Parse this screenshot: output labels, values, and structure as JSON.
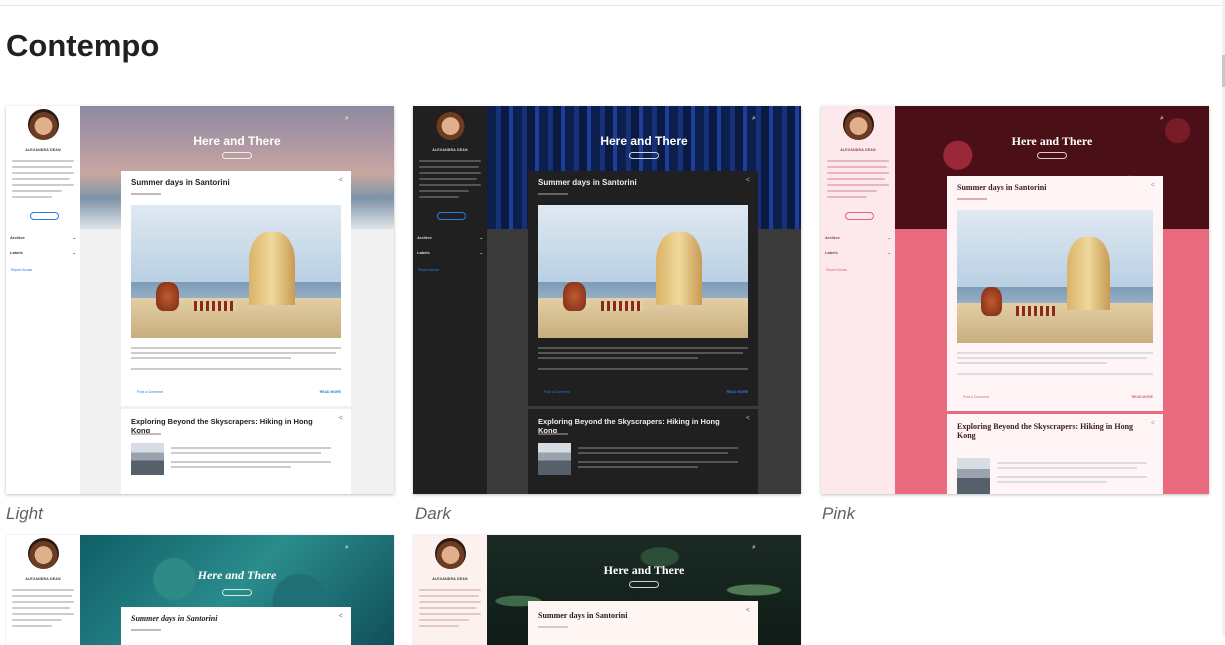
{
  "section": {
    "title": "Contempo"
  },
  "themes": [
    {
      "label": "Light"
    },
    {
      "label": "Dark"
    },
    {
      "label": "Pink"
    },
    {
      "label": ""
    },
    {
      "label": ""
    }
  ],
  "preview": {
    "author": "ALEXANDRA DEAN",
    "blog_title": "Here and There",
    "sidebar_menu": [
      "Archive",
      "Labels"
    ],
    "report_abuse": "Report Abuse",
    "post1_title": "Summer days in Santorini",
    "post2_title": "Exploring Beyond the Skyscrapers: Hiking in Hong Kong",
    "post_comment": "Post a Comment",
    "read_more": "READ MORE"
  },
  "colors": {
    "light_page": "#f1f1f1",
    "dark_page": "#3a3a3a",
    "dark_card": "#202020",
    "pink_page": "#e96b7f",
    "pink_header": "#4a0f17",
    "accent_blue": "#2a7ae2",
    "accent_pink": "#d9667a"
  }
}
